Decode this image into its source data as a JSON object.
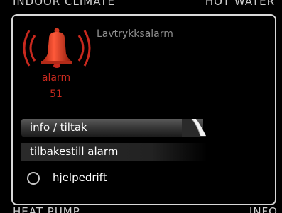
{
  "background": {
    "top_left_label": "INDOOR CLIMATE",
    "top_right_label": "HOT WATER",
    "bottom_left_label": "HEAT PUMP",
    "bottom_right_label": "INFO"
  },
  "dialog": {
    "title": "Lavtrykksalarm",
    "alarm_label": "alarm",
    "alarm_code": "51",
    "icon": "alarm-bell-icon",
    "menu": [
      {
        "label": "info / tiltak",
        "selected": true
      },
      {
        "label": "tilbakestill alarm",
        "selected": false
      }
    ],
    "option": {
      "label": "hjelpedrift",
      "checked": false
    }
  },
  "colors": {
    "alarm_red": "#c9291e",
    "frame": "#d8d8d8",
    "background": "#000000"
  }
}
